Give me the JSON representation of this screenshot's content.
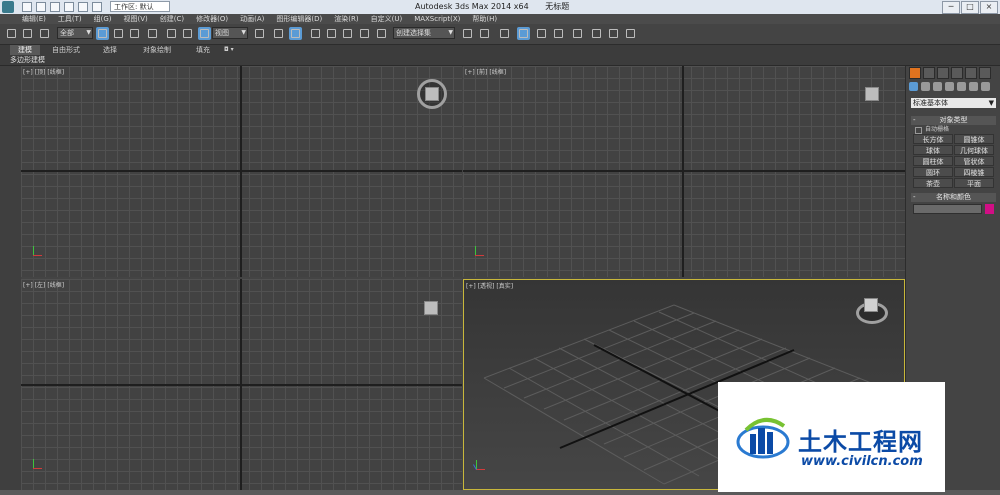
{
  "titlebar": {
    "project_field": "工作区: 默认",
    "title": "Autodesk 3ds Max  2014 x64",
    "doc_name": "无标题",
    "controls": [
      "─",
      "□",
      "×"
    ]
  },
  "menu": [
    "编辑(E)",
    "工具(T)",
    "组(G)",
    "视图(V)",
    "创建(C)",
    "修改器(O)",
    "动画(A)",
    "图形编辑器(D)",
    "渲染(R)",
    "自定义(U)",
    "MAXScript(X)",
    "帮助(H)"
  ],
  "toolbar": {
    "selection_filter": "全部",
    "ref_coord": "视图",
    "named_selection": "创建选择集"
  },
  "ribbon": {
    "tabs": [
      "建模",
      "自由形式",
      "选择",
      "对象绘制",
      "填充"
    ],
    "active": "建模",
    "sub_label": "多边形建模"
  },
  "viewports": {
    "top": {
      "plus": "[+]",
      "view": "[顶]",
      "mode": "[线框]"
    },
    "front": {
      "plus": "[+]",
      "view": "[前]",
      "mode": "[线框]"
    },
    "left": {
      "plus": "[+]",
      "view": "[左]",
      "mode": "[线框]"
    },
    "perspective": {
      "plus": "[+]",
      "view": "[透视]",
      "mode": "[真实]"
    }
  },
  "command_panel": {
    "dropdown": "标准基本体",
    "object_type": {
      "title": "对象类型",
      "autogrid": "自动栅格",
      "buttons": [
        "长方体",
        "圆锥体",
        "球体",
        "几何球体",
        "圆柱体",
        "管状体",
        "圆环",
        "四棱锥",
        "茶壶",
        "平面"
      ]
    },
    "name_color": {
      "title": "名称和颜色",
      "color": "#d10e85"
    }
  },
  "watermark": {
    "name": "土木工程网",
    "url": "www.civilcn.com"
  }
}
